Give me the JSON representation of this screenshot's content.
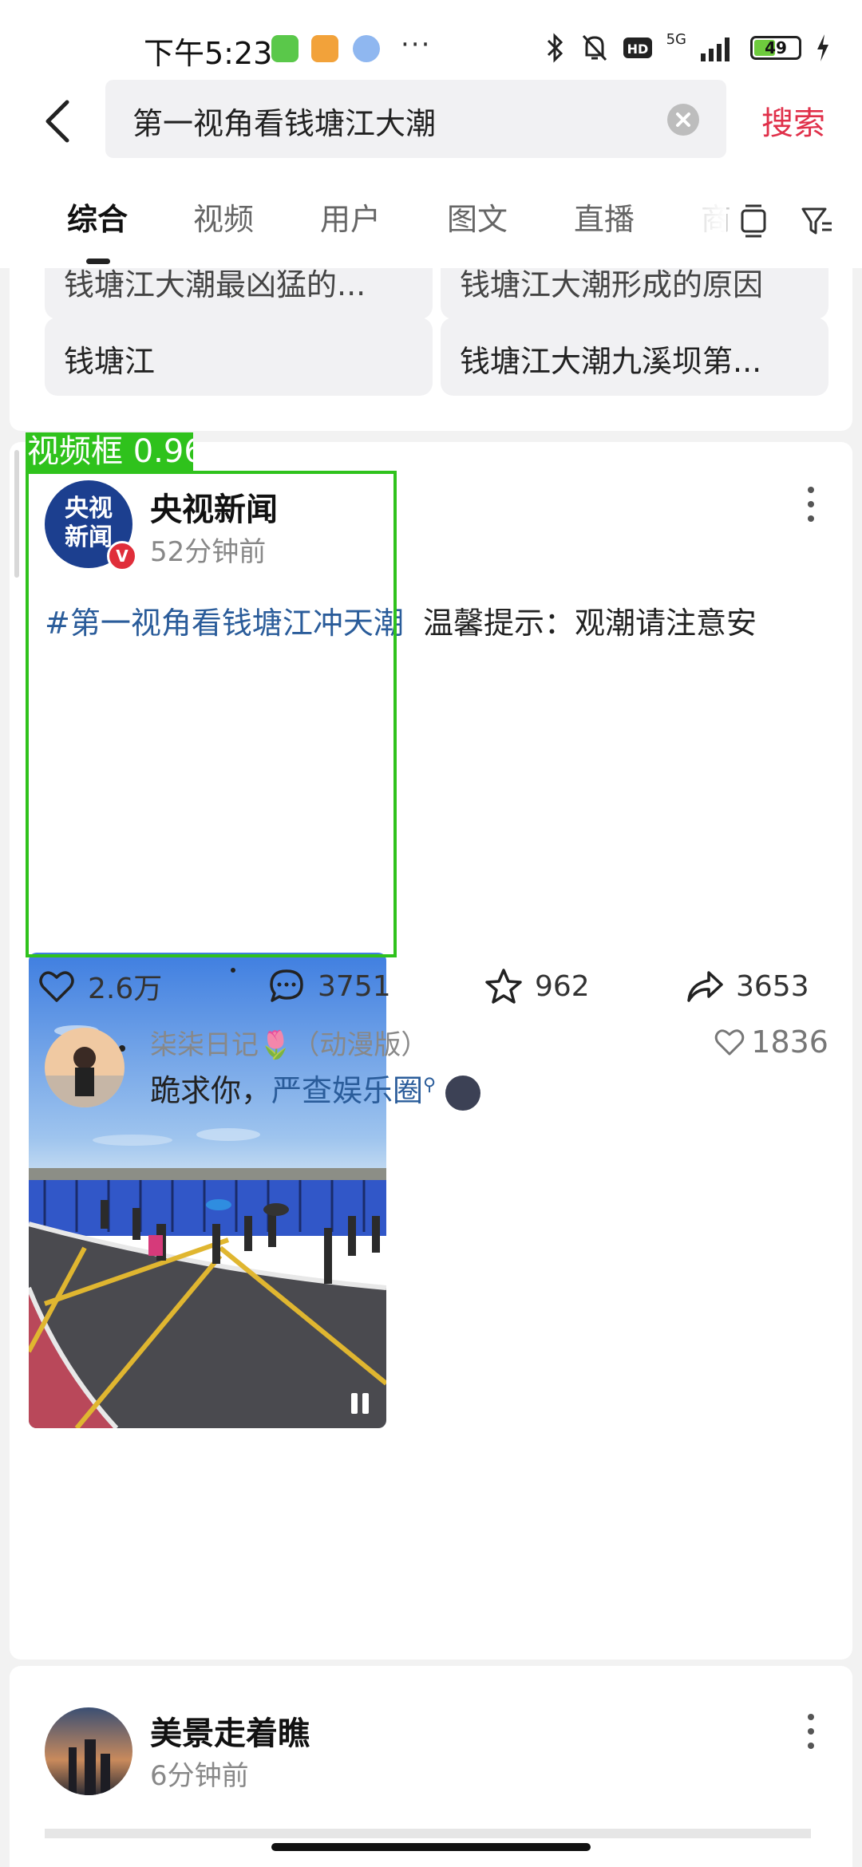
{
  "status_bar": {
    "time": "下午5:23",
    "network": "5G",
    "battery": "49",
    "battery_level": 0.49
  },
  "search": {
    "query": "第一视角看钱塘江大潮",
    "submit_label": "搜索"
  },
  "tabs": [
    {
      "label": "综合",
      "active": true
    },
    {
      "label": "视频",
      "active": false
    },
    {
      "label": "用户",
      "active": false
    },
    {
      "label": "图文",
      "active": false
    },
    {
      "label": "直播",
      "active": false
    },
    {
      "label": "商",
      "active": false
    }
  ],
  "suggestions": [
    {
      "label": "钱塘江大潮最凶猛的..."
    },
    {
      "label": "钱塘江大潮形成的原因"
    },
    {
      "label": "钱塘江"
    },
    {
      "label": "钱塘江大潮九溪坝第..."
    }
  ],
  "post": {
    "author": "央视新闻",
    "avatar_text": "央视新闻",
    "time": "52分钟前",
    "hashtag": "#第一视角看钱塘江冲天潮",
    "text": "温馨提示：观潮请注意安",
    "detection_label": "视频框 0.96",
    "likes": "2.6万",
    "comments": "3751",
    "favorites": "962",
    "shares": "3653"
  },
  "comment": {
    "user": "柒柒日记🌷（动漫版）",
    "text": "跪求你，",
    "link": "严查娱乐圈",
    "likes": "1836"
  },
  "post2": {
    "author": "美景走着瞧",
    "time": "6分钟前"
  },
  "colors": {
    "accent": "#e0304a",
    "link": "#2a5c9a",
    "detection": "#2fc21c"
  }
}
